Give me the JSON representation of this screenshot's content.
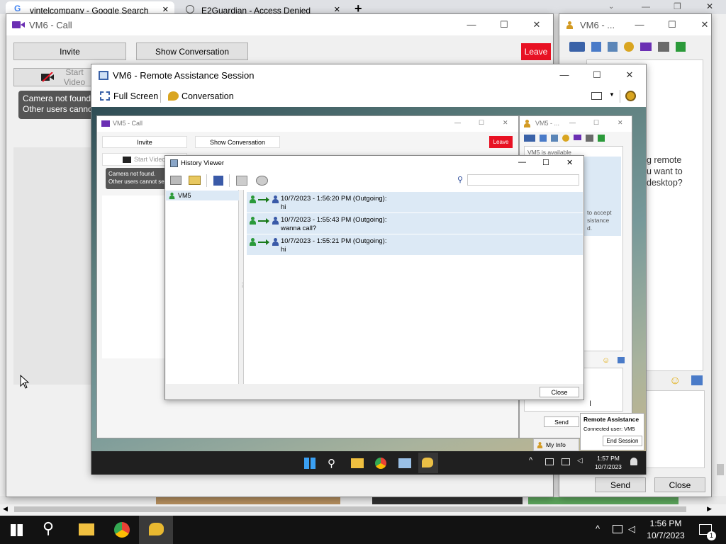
{
  "browser": {
    "tabs": [
      {
        "label": "vintelcompany - Google Search",
        "icon": "google-icon"
      },
      {
        "label": "E2Guardian - Access Denied",
        "icon": "globe-icon"
      }
    ],
    "new_tab_glyph": "+"
  },
  "call_window": {
    "title": "VM6 - Call",
    "invite": "Invite",
    "show_conversation": "Show Conversation",
    "leave": "Leave",
    "start_video": "Start Video",
    "tooltip_line1": "Camera not found.",
    "tooltip_line2": "Other users cannot see"
  },
  "chat_window": {
    "title": "VM6 - ...",
    "side_text_1": "g remote",
    "side_text_2": "u want to",
    "side_text_3": "desktop?",
    "send": "Send",
    "close": "Close"
  },
  "remote_session": {
    "title": "VM6 - Remote Assistance Session",
    "full_screen": "Full Screen",
    "conversation": "Conversation"
  },
  "remote_desktop": {
    "call_title": "VM5 - Call",
    "invite": "Invite",
    "show_conversation": "Show Conversation",
    "leave": "Leave",
    "start_video": "Start Video",
    "tooltip_line1": "Camera not found.",
    "tooltip_line2": "Other users cannot see",
    "chat_title": "VM5 - ...",
    "available": "VM5 is available",
    "accept_1": "to accept",
    "accept_2": "sistance",
    "accept_3": "d.",
    "send": "Send",
    "my_info": "My Info",
    "ra_popup": {
      "title": "Remote Assistance",
      "connected": "Connected user: VM5",
      "end_session": "End Session"
    },
    "taskbar": {
      "time": "1:57 PM",
      "date": "10/7/2023"
    }
  },
  "history_viewer": {
    "title": "History Viewer",
    "search_placeholder": "",
    "contacts": [
      "VM5"
    ],
    "messages": [
      {
        "header": "10/7/2023 - 1:56:20 PM (Outgoing):",
        "body": "hi"
      },
      {
        "header": "10/7/2023 - 1:55:43 PM (Outgoing):",
        "body": "wanna call?"
      },
      {
        "header": "10/7/2023 - 1:55:21 PM (Outgoing):",
        "body": "hi"
      }
    ],
    "close": "Close"
  },
  "taskbar": {
    "time": "1:56 PM",
    "date": "10/7/2023",
    "notification_count": "1"
  },
  "colors": {
    "accent_red": "#e81123",
    "taskbar": "#121212",
    "highlight": "#dce9f5",
    "video_icon": "#6b2fb3"
  }
}
